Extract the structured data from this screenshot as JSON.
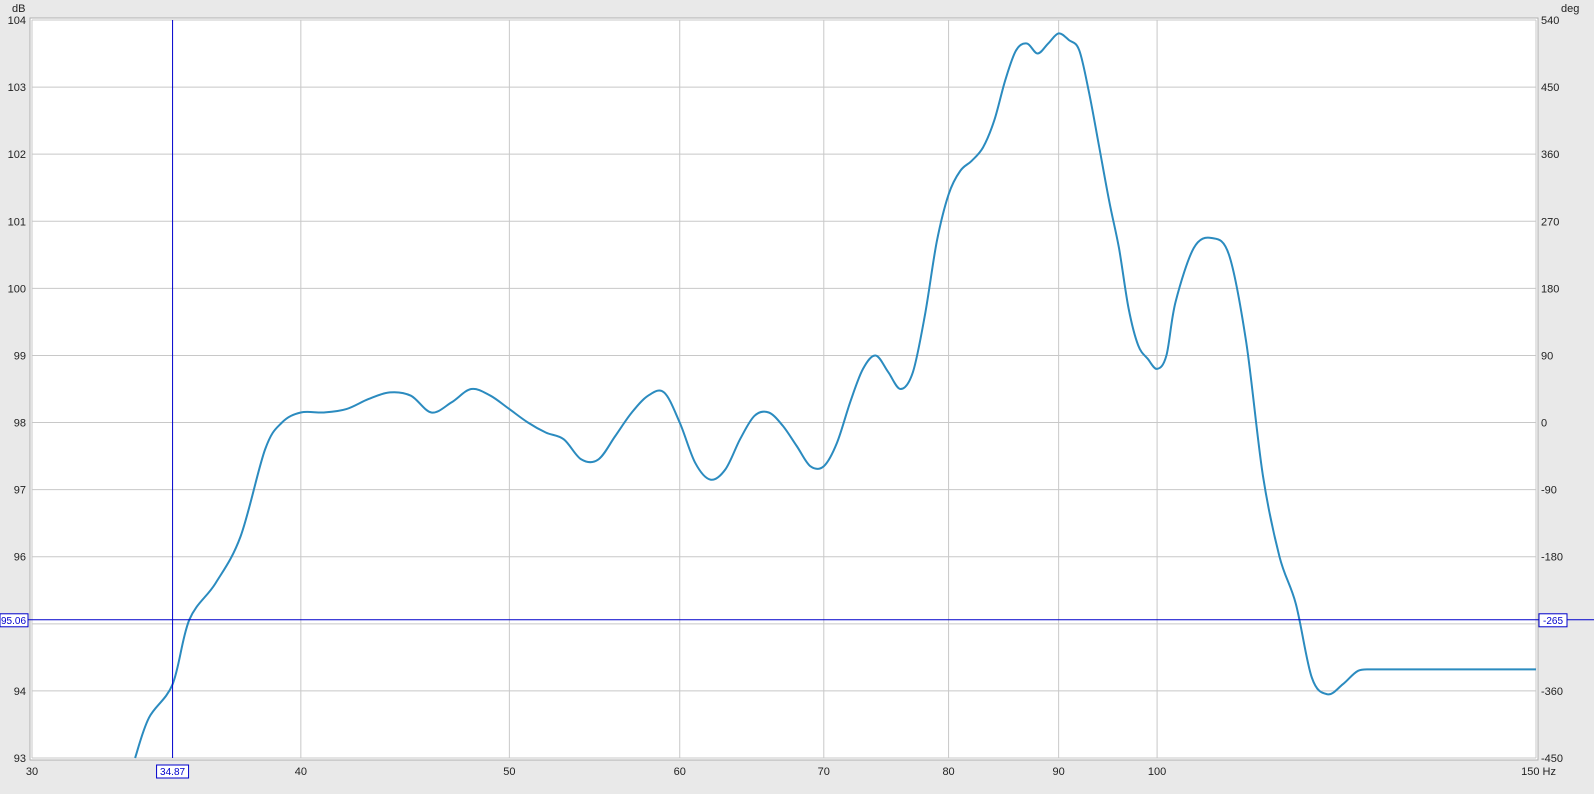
{
  "chart_data": {
    "type": "line",
    "x_axis": {
      "scale": "log",
      "unit": "Hz",
      "range": [
        30,
        150
      ],
      "ticks": [
        {
          "value": 30,
          "label": "30"
        },
        {
          "value": 40,
          "label": "40"
        },
        {
          "value": 50,
          "label": "50"
        },
        {
          "value": 60,
          "label": "60"
        },
        {
          "value": 70,
          "label": "70"
        },
        {
          "value": 80,
          "label": "80"
        },
        {
          "value": 90,
          "label": "90"
        },
        {
          "value": 100,
          "label": "100"
        },
        {
          "value": 150,
          "label": "150 Hz"
        }
      ]
    },
    "y_axis_left": {
      "unit": "dB",
      "range": [
        93,
        104
      ],
      "ticks": [
        "93",
        "94",
        "95",
        "96",
        "97",
        "98",
        "99",
        "100",
        "101",
        "102",
        "103",
        "104"
      ]
    },
    "y_axis_right": {
      "unit": "deg",
      "range": [
        -450,
        540
      ],
      "ticks": [
        "-450",
        "-360",
        "-265",
        "-180",
        "-90",
        "0",
        "90",
        "180",
        "270",
        "360",
        "450",
        "540"
      ]
    },
    "grid": true,
    "cursor": {
      "x": 34.87,
      "x_label": "34.87",
      "y": 95.06,
      "y_label": "95.06",
      "y_right_label": "-265",
      "color": "#0000cc"
    },
    "series": [
      {
        "color": "#2b8bbf",
        "x": [
          33.5,
          34,
          34.87,
          35.5,
          36.5,
          37.5,
          38.5,
          39.2,
          40,
          41,
          42,
          43,
          44,
          45,
          46,
          47,
          48,
          49,
          50,
          51,
          52,
          53,
          54,
          55,
          56,
          57,
          58,
          59,
          60,
          61,
          62,
          63,
          64,
          65,
          66,
          67,
          68,
          69,
          70,
          71,
          72,
          73,
          74,
          75,
          76,
          77,
          78,
          79,
          80,
          81,
          82,
          83,
          84,
          85,
          86,
          87,
          88,
          89,
          90,
          91,
          92,
          93,
          94,
          95,
          96,
          97,
          98,
          99,
          100,
          101,
          102,
          104,
          106,
          108,
          110,
          112,
          114,
          116,
          118,
          120,
          122,
          124,
          126,
          127,
          128,
          130,
          132,
          134,
          136,
          138,
          140,
          142,
          144,
          146,
          148,
          150
        ],
        "y": [
          93.0,
          93.6,
          94.1,
          95.06,
          95.6,
          96.3,
          97.6,
          98.0,
          98.15,
          98.15,
          98.2,
          98.35,
          98.45,
          98.4,
          98.15,
          98.3,
          98.5,
          98.4,
          98.2,
          98.0,
          97.85,
          97.75,
          97.45,
          97.45,
          97.8,
          98.15,
          98.4,
          98.45,
          98.0,
          97.4,
          97.15,
          97.3,
          97.75,
          98.1,
          98.15,
          97.95,
          97.65,
          97.35,
          97.35,
          97.7,
          98.3,
          98.8,
          99.0,
          98.75,
          98.5,
          98.75,
          99.6,
          100.7,
          101.4,
          101.75,
          101.9,
          102.1,
          102.5,
          103.1,
          103.55,
          103.65,
          103.5,
          103.65,
          103.8,
          103.7,
          103.55,
          102.9,
          102.1,
          101.3,
          100.6,
          99.7,
          99.15,
          98.95,
          98.8,
          99.0,
          99.8,
          100.6,
          100.75,
          100.5,
          99.2,
          97.2,
          96.0,
          95.3,
          94.2,
          93.95,
          94.1,
          94.3,
          94.32,
          94.32,
          94.32,
          94.32,
          94.32,
          94.32,
          94.32,
          94.32,
          94.32,
          94.32,
          94.32,
          94.32,
          94.32,
          94.32
        ]
      }
    ]
  }
}
